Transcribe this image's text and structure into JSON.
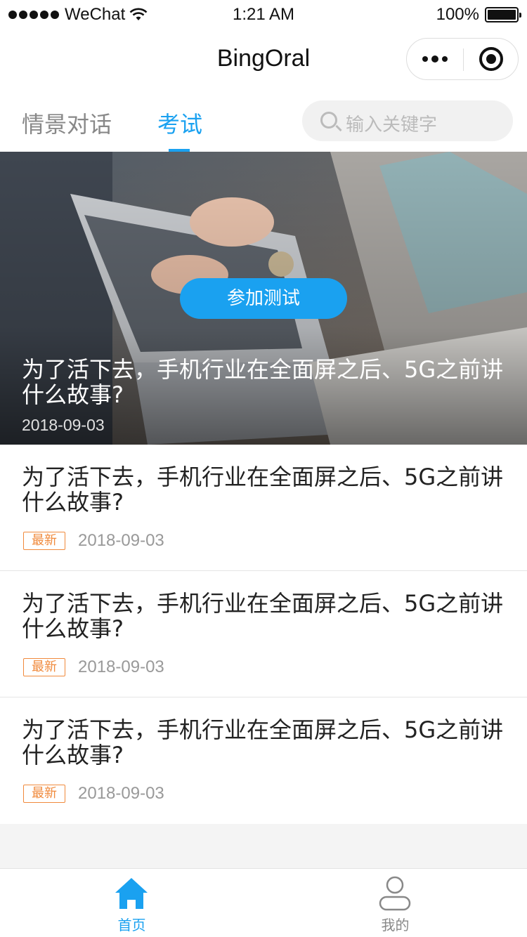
{
  "status_bar": {
    "carrier": "WeChat",
    "time": "1:21 AM",
    "battery": "100%"
  },
  "nav": {
    "title": "BingOral"
  },
  "tabs": [
    {
      "label": "情景对话"
    },
    {
      "label": "考试"
    }
  ],
  "search": {
    "placeholder": "输入关键字"
  },
  "banner": {
    "button_label": "参加测试",
    "title": "为了活下去，手机行业在全面屏之后、5G之前讲什么故事?",
    "date": "2018-09-03"
  },
  "articles": [
    {
      "title": "为了活下去，手机行业在全面屏之后、5G之前讲什么故事?",
      "badge": "最新",
      "date": "2018-09-03"
    },
    {
      "title": "为了活下去，手机行业在全面屏之后、5G之前讲什么故事?",
      "badge": "最新",
      "date": "2018-09-03"
    },
    {
      "title": "为了活下去，手机行业在全面屏之后、5G之前讲什么故事?",
      "badge": "最新",
      "date": "2018-09-03"
    }
  ],
  "tabbar": {
    "home_label": "首页",
    "mine_label": "我的"
  },
  "colors": {
    "accent": "#1aa1f0",
    "badge": "#f08a3c"
  },
  "icons": {
    "signal": "signal-dots-icon",
    "wifi": "wifi-icon",
    "battery": "battery-icon",
    "more": "more-dots-icon",
    "close": "target-circle-icon",
    "search": "search-icon",
    "home": "home-icon",
    "user": "user-icon"
  }
}
